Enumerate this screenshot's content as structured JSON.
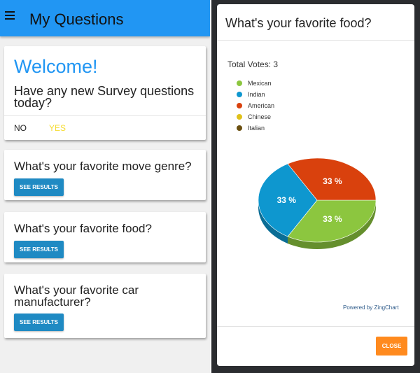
{
  "appbar": {
    "title": "My Questions",
    "menu_icon": "hamburger-menu-icon"
  },
  "welcome_card": {
    "title": "Welcome!",
    "body": "Have any new Survey questions today?",
    "no_label": "NO",
    "yes_label": "YES",
    "yes_color": "#f5dc32"
  },
  "questions": [
    {
      "text": "What's your favorite move genre?",
      "button_label": "SEE RESULTS"
    },
    {
      "text": "What's your favorite food?",
      "button_label": "SEE RESULTS"
    },
    {
      "text": "What's your favorite car manufacturer?",
      "button_label": "SEE RESULTS"
    }
  ],
  "modal": {
    "title": "What's your favorite food?",
    "total_votes": "Total Votes: 3",
    "powered_by": "Powered by ZingChart",
    "close_label": "CLOSE",
    "close_color": "#ff8a1e"
  },
  "colors": {
    "brand": "#2196f3",
    "button": "#1f8ac3"
  },
  "chart_data": {
    "type": "pie",
    "categories": [
      "Mexican",
      "Indian",
      "American",
      "Chinese",
      "Italian"
    ],
    "values": [
      1,
      1,
      1,
      0,
      0
    ],
    "colors": [
      "#8cc63f",
      "#0e97cf",
      "#d9410d",
      "#e0c11a",
      "#6b4f10"
    ],
    "slice_labels": [
      "33 %",
      "33 %",
      "33 %"
    ],
    "legend_position": "top-left",
    "style": "3d"
  }
}
